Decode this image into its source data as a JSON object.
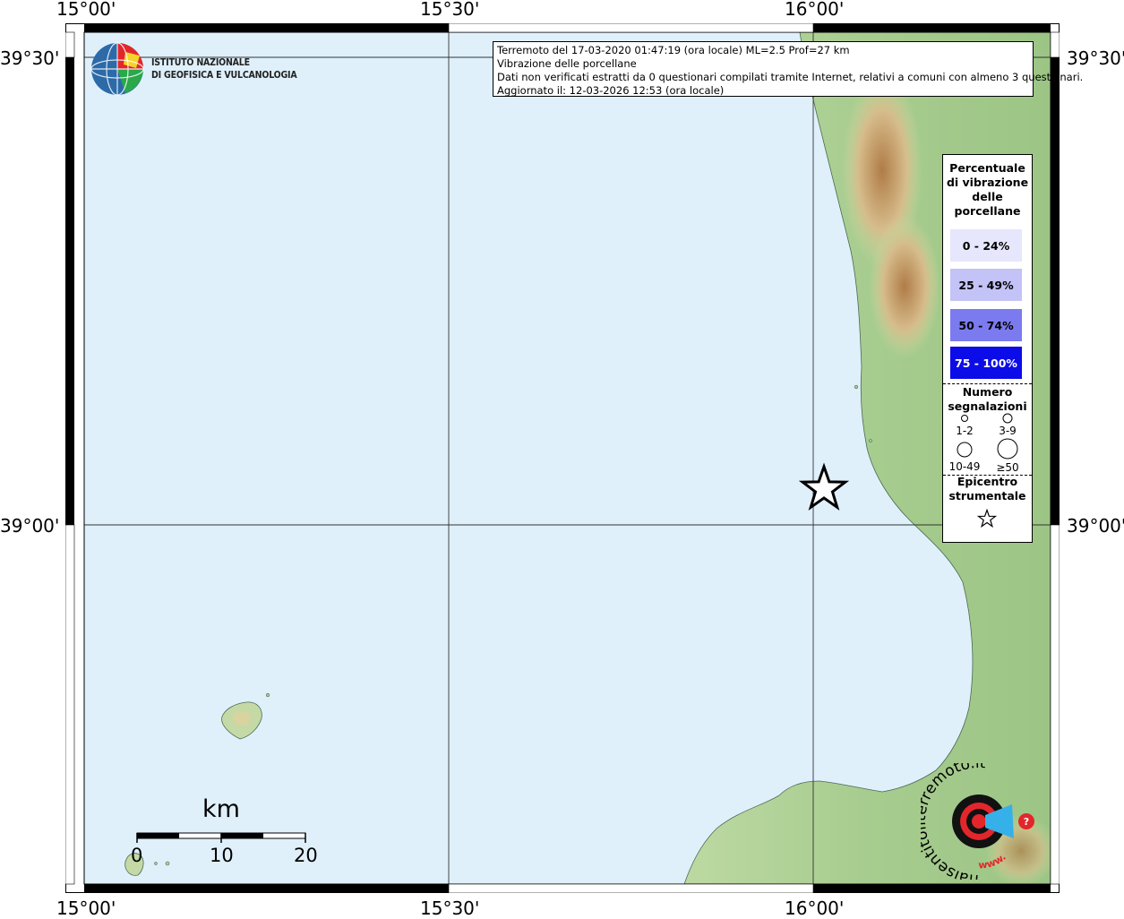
{
  "axes": {
    "top": [
      "15°00'",
      "15°30'",
      "16°00'"
    ],
    "bottom": [
      "15°00'",
      "15°30'",
      "16°00'"
    ],
    "left": [
      "39°30'",
      "39°00'"
    ],
    "right": [
      "39°30'",
      "39°00'"
    ]
  },
  "logo": {
    "line1": "ISTITUTO NAZIONALE",
    "line2": "DI GEOFISICA E VULCANOLOGIA"
  },
  "info": {
    "line1": "Terremoto del 17-03-2020 01:47:19 (ora locale) ML=2.5 Prof=27 km",
    "line2": "Vibrazione delle porcellane",
    "line3": "Dati non verificati estratti da 0 questionari compilati tramite Internet, relativi a comuni con almeno 3 questionari.",
    "line4": "Aggiornato il: 12-03-2026 12:53 (ora locale)"
  },
  "legend": {
    "title_lines": [
      "Percentuale",
      "di vibrazione",
      "delle",
      "porcellane"
    ],
    "classes": [
      {
        "label": "0 - 24%",
        "color": "#e6e6fc",
        "text_color": "#000000"
      },
      {
        "label": "25 - 49%",
        "color": "#c3c3f7",
        "text_color": "#000000"
      },
      {
        "label": "50 - 74%",
        "color": "#7b7bef",
        "text_color": "#000000"
      },
      {
        "label": "75 - 100%",
        "color": "#0c0ce8",
        "text_color": "#ffffff"
      }
    ],
    "count_title_lines": [
      "Numero",
      "segnalazioni"
    ],
    "counts": [
      "1-2",
      "3-9",
      "10-49",
      "≥50"
    ],
    "epicenter_title_lines": [
      "Epicentro",
      "strumentale"
    ]
  },
  "scale": {
    "unit": "km",
    "ticks": [
      "0",
      "10",
      "20"
    ]
  },
  "watermark": {
    "text": "haisentitoilterremoto.it",
    "url_text": "www."
  },
  "colors": {
    "sea": "#dff0fb",
    "land_low": "#a8cf94",
    "land_mid": "#d9c89a",
    "land_high": "#b88a55",
    "accent_red": "#e3262b"
  }
}
